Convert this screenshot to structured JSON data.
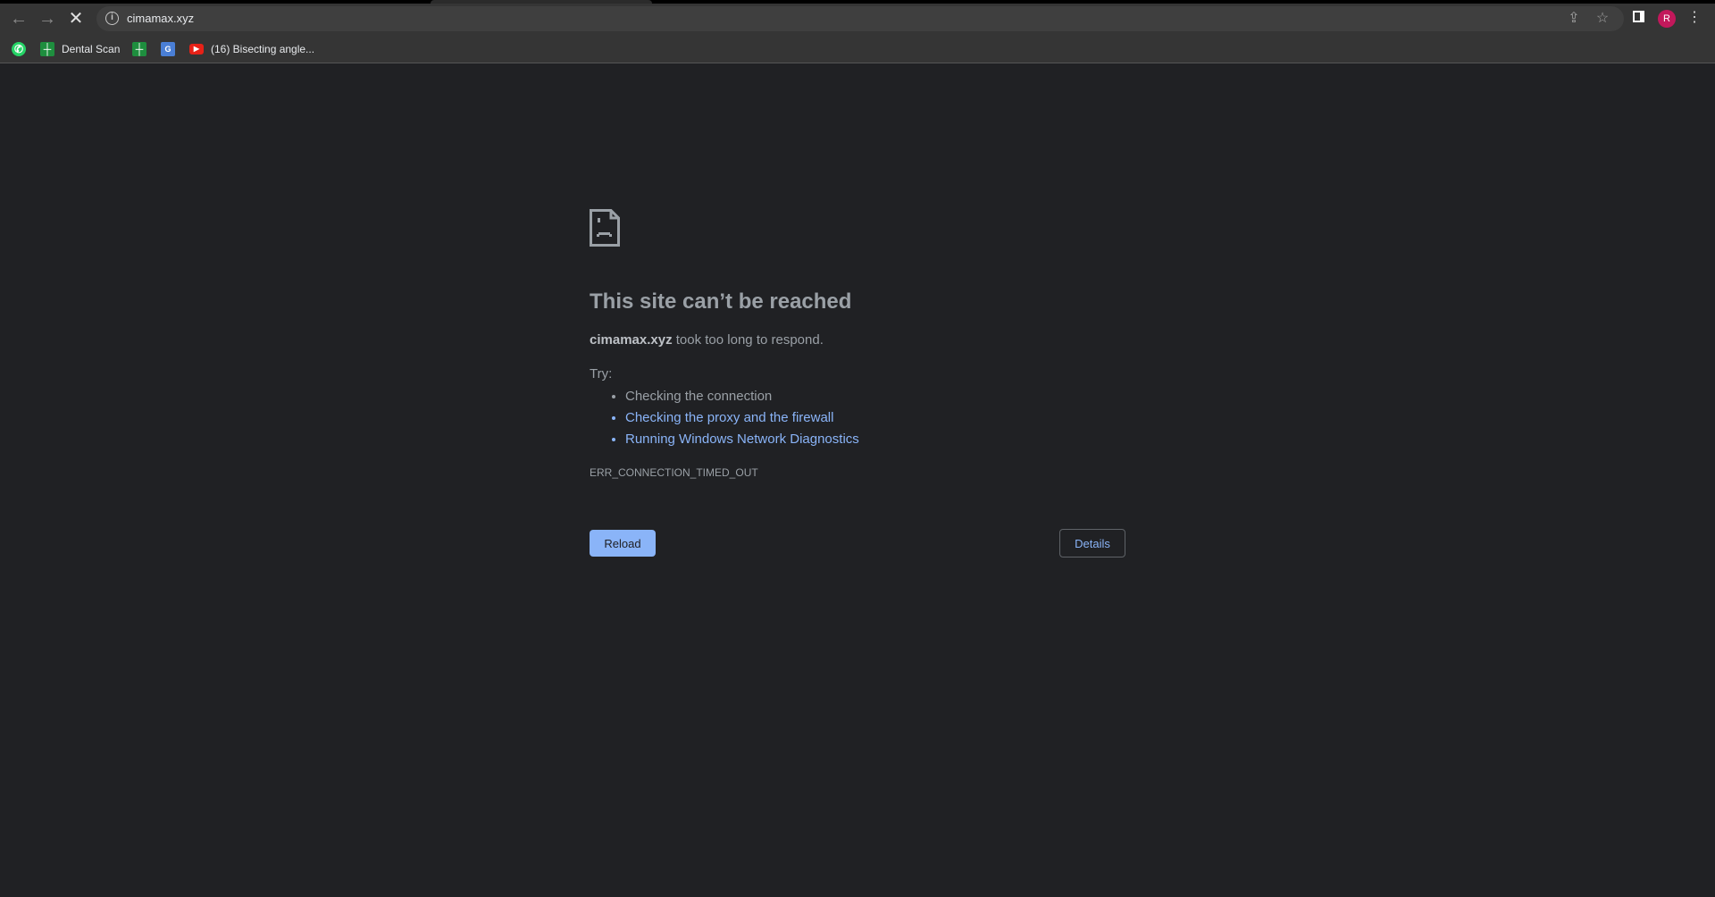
{
  "browser": {
    "url": "cimamax.xyz",
    "avatar_letter": "R",
    "bookmarks": [
      {
        "icon": "whatsapp-icon",
        "label": ""
      },
      {
        "icon": "google-sheets-icon",
        "label": "Dental Scan"
      },
      {
        "icon": "google-sheets-icon",
        "label": ""
      },
      {
        "icon": "google-translate-icon",
        "label": ""
      },
      {
        "icon": "youtube-icon",
        "label": "(16) Bisecting angle..."
      }
    ]
  },
  "error": {
    "title": "This site can’t be reached",
    "host": "cimamax.xyz",
    "message": "took too long to respond.",
    "try_label": "Try:",
    "suggestions": [
      "Checking the connection",
      "Checking the proxy and the firewall",
      "Running Windows Network Diagnostics"
    ],
    "code": "ERR_CONNECTION_TIMED_OUT",
    "reload_label": "Reload",
    "details_label": "Details"
  },
  "colors": {
    "link": "#8ab4f8",
    "background": "#202124",
    "avatar": "#c2185b"
  }
}
